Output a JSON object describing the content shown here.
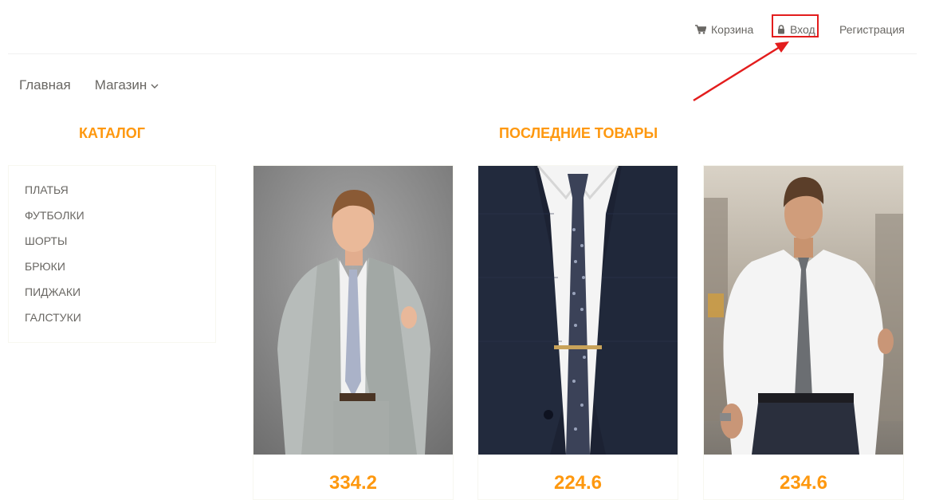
{
  "header": {
    "cart_label": "Корзина",
    "login_label": "Вход",
    "register_label": "Регистрация"
  },
  "icons": {
    "cart": "cart-icon",
    "login": "lock-icon",
    "dropdown": "chevron-down-icon"
  },
  "nav": {
    "home": "Главная",
    "shop": "Магазин"
  },
  "catalog": {
    "title": "КАТАЛОГ",
    "items": [
      "ПЛАТЬЯ",
      "ФУТБОЛКИ",
      "ШОРТЫ",
      "БРЮКИ",
      "ПИДЖАКИ",
      "ГАЛСТУКИ"
    ]
  },
  "latest": {
    "title": "ПОСЛЕДНИЕ ТОВАРЫ",
    "products": [
      {
        "price": "334.2"
      },
      {
        "price": "224.6"
      },
      {
        "price": "234.6"
      }
    ]
  },
  "colors": {
    "accent": "#fe980f",
    "text": "#696763",
    "highlight": "#e31d1d"
  }
}
